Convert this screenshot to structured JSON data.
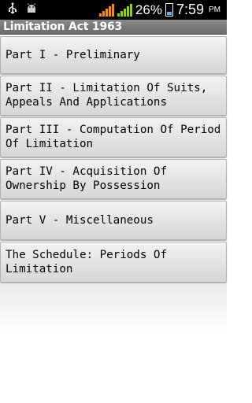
{
  "status_bar": {
    "icons": [
      "usb-icon",
      "android-icon"
    ],
    "battery_percent": "26%",
    "time": "7:59",
    "ampm": "PM"
  },
  "app": {
    "title": "Limitation Act 1963"
  },
  "list": {
    "items": [
      {
        "label": "Part I - Preliminary"
      },
      {
        "label": "Part II - Limitation Of Suits,\nAppeals And Applications"
      },
      {
        "label": "Part III - Computation Of Period\nOf Limitation"
      },
      {
        "label": "Part IV - Acquisition Of\nOwnership By Possession"
      },
      {
        "label": "Part V - Miscellaneous"
      },
      {
        "label": "The Schedule: Periods Of\nLimitation"
      }
    ]
  },
  "colors": {
    "status_bar": "#000000",
    "title_bar": "#7a7a7a",
    "signal_orange": "#ff8a00",
    "signal_green": "#8fd400",
    "battery_fill": "#4fb8ff"
  }
}
